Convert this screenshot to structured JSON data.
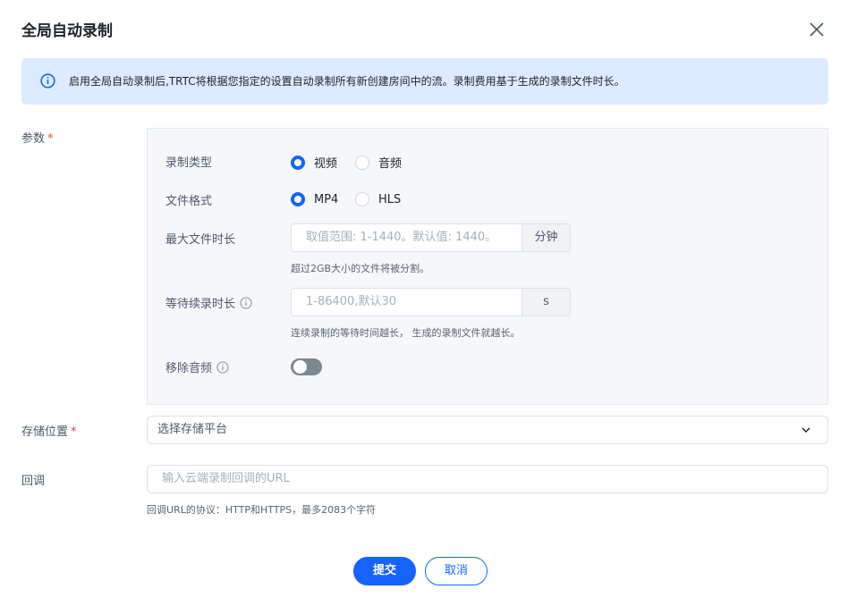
{
  "dialog": {
    "title": "全局自动录制",
    "close_icon": "close-icon"
  },
  "banner": {
    "icon": "info-icon",
    "text": "启用全局自动录制后,TRTC将根据您指定的设置自动录制所有新创建房间中的流。录制费用基于生成的录制文件时长。",
    "accent": "#1664ff",
    "background": "#dcebff"
  },
  "params": {
    "label": "参数",
    "required_mark": "*",
    "record_type": {
      "label": "录制类型",
      "options": [
        {
          "label": "视频",
          "selected": true
        },
        {
          "label": "音频",
          "selected": false
        }
      ]
    },
    "file_format": {
      "label": "文件格式",
      "options": [
        {
          "label": "MP4",
          "selected": true
        },
        {
          "label": "HLS",
          "selected": false
        }
      ]
    },
    "max_duration": {
      "label": "最大文件时长",
      "placeholder": "取值范围: 1-1440。默认值: 1440。",
      "unit": "分钟",
      "hint": "超过2GB大小的文件将被分割。"
    },
    "wait_duration": {
      "label": "等待续录时长",
      "help_icon": "info-circle-icon",
      "placeholder": "1-86400,默认30",
      "unit": "s",
      "hint": "连续录制的等待时间越长， 生成的录制文件就越长。"
    },
    "remove_audio": {
      "label": "移除音频",
      "help_icon": "info-circle-icon",
      "enabled": false
    }
  },
  "storage": {
    "label": "存储位置",
    "required_mark": "*",
    "placeholder": "选择存储平台",
    "icon": "chevron-down-icon"
  },
  "callback": {
    "label": "回调",
    "placeholder": "输入云端录制回调的URL",
    "hint": "回调URL的协议：HTTP和HTTPS，最多2083个字符"
  },
  "actions": {
    "submit": "提交",
    "cancel": "取消"
  }
}
